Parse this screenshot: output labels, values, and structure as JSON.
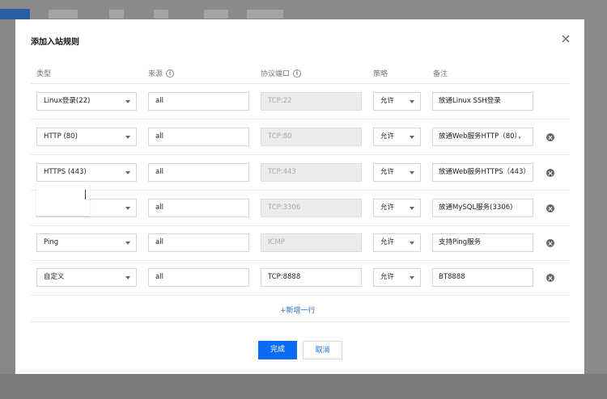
{
  "modal": {
    "title": "添加入站规则",
    "close_icon": "close-icon"
  },
  "table": {
    "headers": {
      "type": "类型",
      "source": "来源",
      "port": "协议端口",
      "policy": "策略",
      "remark": "备注"
    },
    "rows": [
      {
        "type": "Linux登录(22)",
        "source": "all",
        "port": "TCP:22",
        "policy": "允许",
        "remark": "放通Linux SSH登录",
        "port_disabled": true,
        "deletable": false
      },
      {
        "type": "HTTP (80)",
        "source": "all",
        "port": "TCP:80",
        "policy": "允许",
        "remark": "放通Web服务HTTP（80），",
        "port_disabled": true,
        "deletable": true
      },
      {
        "type": "HTTPS (443)",
        "source": "all",
        "port": "TCP:443",
        "policy": "允许",
        "remark": "放通Web服务HTTPS（443）",
        "port_disabled": true,
        "deletable": true
      },
      {
        "type": "",
        "source": "all",
        "port": "TCP:3306",
        "policy": "允许",
        "remark": "放通MySQL服务(3306)",
        "port_disabled": true,
        "deletable": true
      },
      {
        "type": "Ping",
        "source": "all",
        "port": "ICMP",
        "policy": "允许",
        "remark": "支持Ping服务",
        "port_disabled": true,
        "deletable": true
      },
      {
        "type": "自定义",
        "source": "all",
        "port": "TCP:8888",
        "policy": "允许",
        "remark": "BT8888",
        "port_disabled": false,
        "deletable": true
      }
    ]
  },
  "actions": {
    "add_row": "+新增一行",
    "confirm": "完成",
    "cancel": "取消"
  },
  "colors": {
    "primary": "#0a6cf5",
    "link": "#1f6fd6"
  }
}
